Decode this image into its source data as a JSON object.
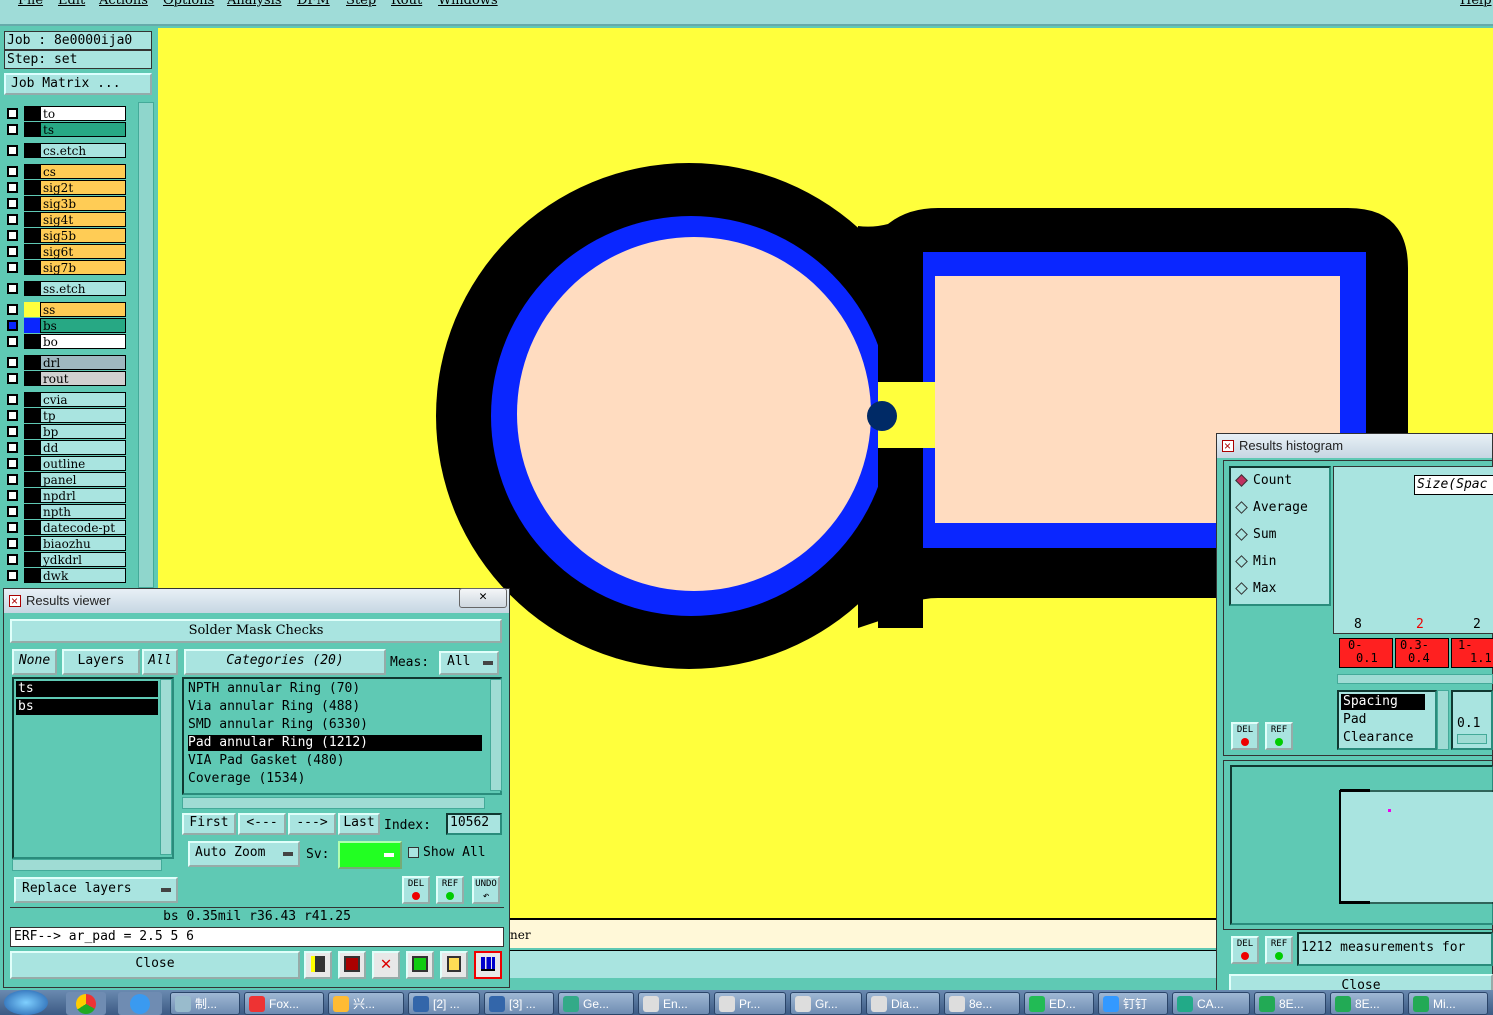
{
  "menu": {
    "items": [
      "File",
      "Edit",
      "Actions",
      "Options",
      "Analysis",
      "DFM",
      "Step",
      "Rout",
      "Windows"
    ],
    "help": "Help"
  },
  "job": {
    "job_line": "Job : 8e0000ija0",
    "step_line": "Step: set",
    "matrix_button": "Job Matrix ..."
  },
  "layers": [
    {
      "name": "to",
      "bg": "#ffffff"
    },
    {
      "name": "ts",
      "bg": "#27a884"
    },
    {
      "name": "cs.etch",
      "bg": "#a9e4e0"
    },
    {
      "name": "cs",
      "bg": "#ffcc55"
    },
    {
      "name": "sig2t",
      "bg": "#ffcc55"
    },
    {
      "name": "sig3b",
      "bg": "#ffcc55"
    },
    {
      "name": "sig4t",
      "bg": "#ffcc55"
    },
    {
      "name": "sig5b",
      "bg": "#ffcc55"
    },
    {
      "name": "sig6t",
      "bg": "#ffcc55"
    },
    {
      "name": "sig7b",
      "bg": "#ffcc55"
    },
    {
      "name": "ss.etch",
      "bg": "#a9e4e0"
    },
    {
      "name": "ss",
      "bg": "#ffcc55"
    },
    {
      "name": "bs",
      "bg": "#27a884"
    },
    {
      "name": "bo",
      "bg": "#ffffff"
    },
    {
      "name": "drl",
      "bg": "#9fb8c0"
    },
    {
      "name": "rout",
      "bg": "#d0d0d0"
    },
    {
      "name": "cvia",
      "bg": "#a9e4e0"
    },
    {
      "name": "tp",
      "bg": "#a9e4e0"
    },
    {
      "name": "bp",
      "bg": "#a9e4e0"
    },
    {
      "name": "dd",
      "bg": "#a9e4e0"
    },
    {
      "name": "outline",
      "bg": "#a9e4e0"
    },
    {
      "name": "panel",
      "bg": "#a9e4e0"
    },
    {
      "name": "npdrl",
      "bg": "#a9e4e0"
    },
    {
      "name": "npth",
      "bg": "#a9e4e0"
    },
    {
      "name": "datecode-pt",
      "bg": "#a9e4e0"
    },
    {
      "name": "biaozhu",
      "bg": "#a9e4e0"
    },
    {
      "name": "ydkdrl",
      "bg": "#a9e4e0"
    },
    {
      "name": "dwk",
      "bg": "#a9e4e0"
    }
  ],
  "results_viewer": {
    "title": "Results viewer",
    "header": "Solder Mask Checks",
    "none_btn": "None",
    "layers_btn": "Layers",
    "all_btn": "All",
    "categories_btn": "Categories (20)",
    "meas_label": "Meas:",
    "meas_value": "All",
    "selected_layers": [
      "ts",
      "bs"
    ],
    "categories": [
      "NPTH annular Ring (70)",
      "Via annular Ring (488)",
      "SMD annular Ring (6330)",
      "Pad annular Ring (1212)",
      "VIA Pad Gasket (480)",
      "Coverage (1534)"
    ],
    "first_btn": "First",
    "prev_btn": "<---",
    "next_btn": "--->",
    "last_btn": "Last",
    "index_label": "Index:",
    "index_value": "10562",
    "auto_zoom": "Auto Zoom",
    "sv_label": "Sv:",
    "show_all": "Show All",
    "replace_layers": "Replace layers",
    "del": "DEL",
    "ref": "REF",
    "undo": "UNDO",
    "status_line": "bs 0.35mil  r36.43  r41.25",
    "erf_line": "ERF--> ar_pad = 2.5 5 6",
    "close_btn": "Close",
    "close_x": "✕"
  },
  "histogram": {
    "title": "Results histogram",
    "modes": [
      "Count",
      "Average",
      "Sum",
      "Min",
      "Max"
    ],
    "size_label": "Size(Spac",
    "bin_counts": [
      "8",
      "2",
      "2"
    ],
    "bin_labels": [
      [
        "0-",
        "0.1"
      ],
      [
        "0.3-",
        "0.4"
      ],
      [
        "1-",
        "1.1"
      ]
    ],
    "measures": [
      "Spacing",
      "Pad",
      "Clearance"
    ],
    "scale_value": "0.1",
    "measurements_text": "1212 measurements for",
    "close_btn": "Close"
  },
  "canvas": {
    "bottom_text": "ner"
  },
  "taskbar": {
    "items": [
      "制...",
      "Fox...",
      "兴...",
      "[2] ...",
      "[3] ...",
      "Ge...",
      "En...",
      "Pr...",
      "Gr...",
      "Dia...",
      "8e...",
      "ED...",
      "钉钉",
      "CA...",
      "8E...",
      "8E...",
      "Mi..."
    ]
  },
  "colors": {
    "bg_teal": "#5fc9b4",
    "canvas_yellow": "#ffff3c",
    "pad_fill": "#ffdcc0",
    "mask_blue": "#0a26ff",
    "selected_red": "#ff2020"
  }
}
